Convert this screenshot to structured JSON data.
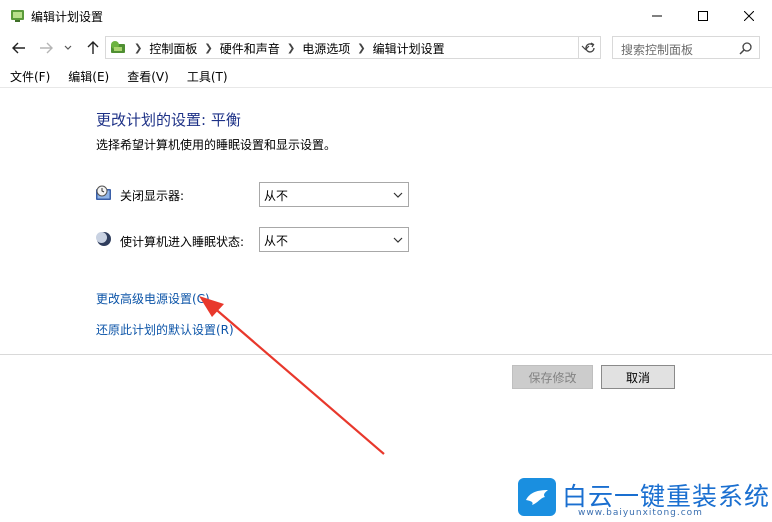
{
  "window": {
    "title": "编辑计划设置",
    "minimize_glyph": "—",
    "maximize_glyph": "☐",
    "close_glyph": "✕"
  },
  "nav": {
    "breadcrumbs": [
      "控制面板",
      "硬件和声音",
      "电源选项",
      "编辑计划设置"
    ],
    "search_placeholder": "搜索控制面板"
  },
  "menu": {
    "items": [
      "文件(F)",
      "编辑(E)",
      "查看(V)",
      "工具(T)"
    ]
  },
  "content": {
    "title": "更改计划的设置: 平衡",
    "subtitle": "选择希望计算机使用的睡眠设置和显示设置。",
    "settings": [
      {
        "label": "关闭显示器:",
        "value": "从不",
        "icon": "monitor-clock-icon"
      },
      {
        "label": "使计算机进入睡眠状态:",
        "value": "从不",
        "icon": "moon-icon"
      }
    ],
    "links": [
      "更改高级电源设置(C)",
      "还原此计划的默认设置(R)"
    ]
  },
  "buttons": {
    "save": "保存修改",
    "cancel": "取消"
  },
  "watermark": {
    "name": "白云一键重装系统",
    "url": "www.baiyunxitong.com",
    "color": "#1a6fd0"
  },
  "colors": {
    "title": "#1e3287",
    "link": "#0d55a8",
    "annotation_arrow": "#e8382c"
  }
}
